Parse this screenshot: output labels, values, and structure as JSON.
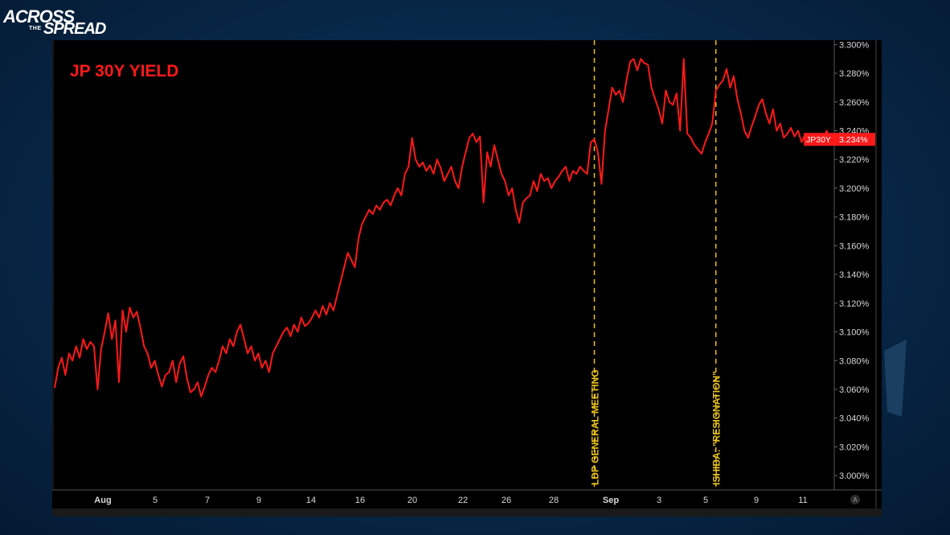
{
  "logo": {
    "line1": "ACROSS",
    "line2": "THE",
    "line3": "SPREAD"
  },
  "colors": {
    "series": "#ff1a1a",
    "annotation": "#e8c21c",
    "axis_text": "#d8d8d8",
    "background": "#000000"
  },
  "chart_data": {
    "type": "line",
    "title": "JP 30Y YIELD",
    "xlabel": "",
    "ylabel": "",
    "ylim": [
      2.99,
      3.303
    ],
    "y_ticks": [
      "3.000%",
      "3.020%",
      "3.040%",
      "3.060%",
      "3.080%",
      "3.100%",
      "3.120%",
      "3.140%",
      "3.160%",
      "3.180%",
      "3.200%",
      "3.220%",
      "3.240%",
      "3.260%",
      "3.280%",
      "3.300%"
    ],
    "x_ticks": [
      "Aug",
      "5",
      "7",
      "9",
      "14",
      "16",
      "20",
      "22",
      "26",
      "28",
      "Sep",
      "3",
      "5",
      "9",
      "11"
    ],
    "grid": false,
    "series": [
      {
        "name": "JP30Y",
        "last_value_label": "3.234%",
        "values": [
          3.061,
          3.075,
          3.082,
          3.07,
          3.085,
          3.08,
          3.09,
          3.082,
          3.095,
          3.088,
          3.093,
          3.09,
          3.06,
          3.088,
          3.1,
          3.113,
          3.095,
          3.108,
          3.065,
          3.115,
          3.1,
          3.117,
          3.11,
          3.114,
          3.103,
          3.09,
          3.085,
          3.075,
          3.08,
          3.07,
          3.062,
          3.07,
          3.072,
          3.08,
          3.065,
          3.078,
          3.083,
          3.068,
          3.058,
          3.06,
          3.065,
          3.055,
          3.062,
          3.07,
          3.075,
          3.072,
          3.08,
          3.09,
          3.085,
          3.095,
          3.09,
          3.1,
          3.105,
          3.095,
          3.085,
          3.09,
          3.08,
          3.085,
          3.075,
          3.08,
          3.072,
          3.085,
          3.09,
          3.095,
          3.1,
          3.103,
          3.097,
          3.105,
          3.1,
          3.11,
          3.104,
          3.106,
          3.11,
          3.115,
          3.11,
          3.118,
          3.112,
          3.12,
          3.115,
          3.125,
          3.135,
          3.145,
          3.155,
          3.15,
          3.145,
          3.165,
          3.175,
          3.18,
          3.185,
          3.182,
          3.188,
          3.185,
          3.19,
          3.192,
          3.188,
          3.195,
          3.2,
          3.195,
          3.21,
          3.215,
          3.235,
          3.22,
          3.215,
          3.218,
          3.212,
          3.216,
          3.21,
          3.22,
          3.214,
          3.205,
          3.21,
          3.215,
          3.205,
          3.2,
          3.215,
          3.225,
          3.235,
          3.238,
          3.232,
          3.236,
          3.19,
          3.225,
          3.215,
          3.23,
          3.22,
          3.21,
          3.205,
          3.195,
          3.2,
          3.185,
          3.176,
          3.19,
          3.193,
          3.195,
          3.205,
          3.198,
          3.21,
          3.205,
          3.207,
          3.2,
          3.205,
          3.208,
          3.212,
          3.215,
          3.205,
          3.212,
          3.21,
          3.215,
          3.212,
          3.21,
          3.232,
          3.234,
          3.225,
          3.203,
          3.24,
          3.255,
          3.27,
          3.265,
          3.268,
          3.26,
          3.275,
          3.288,
          3.29,
          3.282,
          3.29,
          3.287,
          3.286,
          3.27,
          3.262,
          3.255,
          3.245,
          3.268,
          3.26,
          3.258,
          3.266,
          3.24,
          3.29,
          3.238,
          3.235,
          3.23,
          3.227,
          3.224,
          3.232,
          3.238,
          3.245,
          3.268,
          3.272,
          3.275,
          3.283,
          3.27,
          3.278,
          3.262,
          3.252,
          3.24,
          3.235,
          3.243,
          3.25,
          3.258,
          3.262,
          3.252,
          3.245,
          3.255,
          3.24,
          3.245,
          3.235,
          3.238,
          3.242,
          3.236,
          3.24,
          3.232,
          3.238,
          3.23,
          3.236,
          3.232,
          3.238,
          3.235,
          3.24,
          3.234
        ]
      }
    ],
    "annotations": [
      {
        "label": "LDP GENERAL MEETING",
        "index": 151
      },
      {
        "label": "ISHIBA: \"RESIGNATION\"",
        "index": 185
      }
    ]
  }
}
